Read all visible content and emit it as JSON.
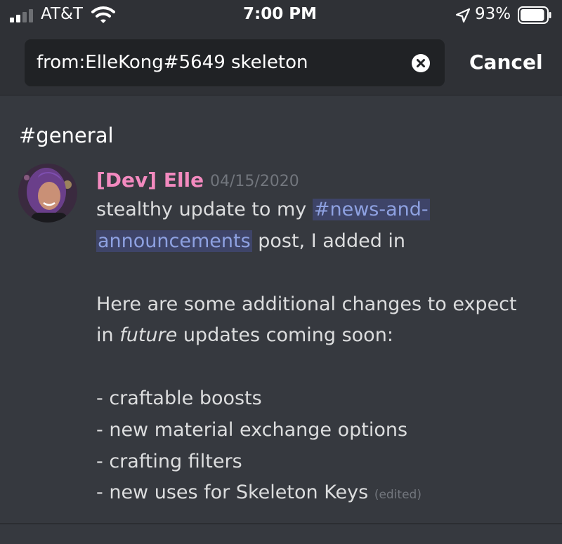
{
  "status_bar": {
    "carrier": "AT&T",
    "time": "7:00 PM",
    "battery_percent": "93%",
    "signal_bars": 2,
    "battery_level": 0.93
  },
  "search": {
    "query": "from:ElleKong#5649 skeleton",
    "cancel_label": "Cancel"
  },
  "results": {
    "channel": "#general",
    "message": {
      "author": "[Dev] Elle",
      "timestamp": "04/15/2020",
      "line1_text": "stealthy update to my ",
      "mention_part1": "#news-and-",
      "mention_part2": "announcements",
      "line2_text": " post, I added in",
      "line3": "Here are some additional changes to expect",
      "line4_pre": "in ",
      "line4_italic": "future",
      "line4_post": " updates coming soon:",
      "bullet1": "- craftable boosts",
      "bullet2": "- new material exchange options",
      "bullet3": "- crafting filters",
      "bullet4": "- new uses for Skeleton Keys",
      "edited_label": "(edited)"
    }
  },
  "colors": {
    "background": "#36393f",
    "header_background": "#2f3136",
    "search_field": "#202225",
    "author": "#f38abf",
    "mention_text": "#8ea1e1",
    "mention_background": "#3e4468",
    "muted": "#72767d"
  }
}
